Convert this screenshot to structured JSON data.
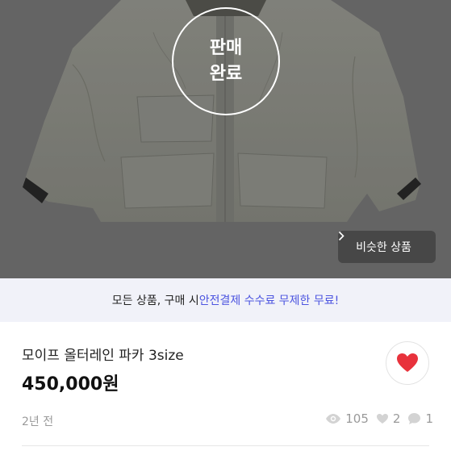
{
  "product_image": {
    "sold_badge": {
      "line1": "판매",
      "line2": "완료"
    },
    "similar_button": {
      "label": "비슷한 상품",
      "icon": "chevron-right-icon"
    }
  },
  "banner": {
    "text_before": "모든 상품, 구매 시 ",
    "text_highlight": "안전결제 수수료 무제한 무료!",
    "highlight_color": "#4c54e0"
  },
  "product": {
    "title": "모이프 올터레인 파카 3size",
    "price": "450,000원",
    "posted_ago": "2년 전",
    "like_icon": "heart-icon",
    "like_color": "#e8323c"
  },
  "stats": {
    "views": "105",
    "likes": "2",
    "chats": "1"
  }
}
